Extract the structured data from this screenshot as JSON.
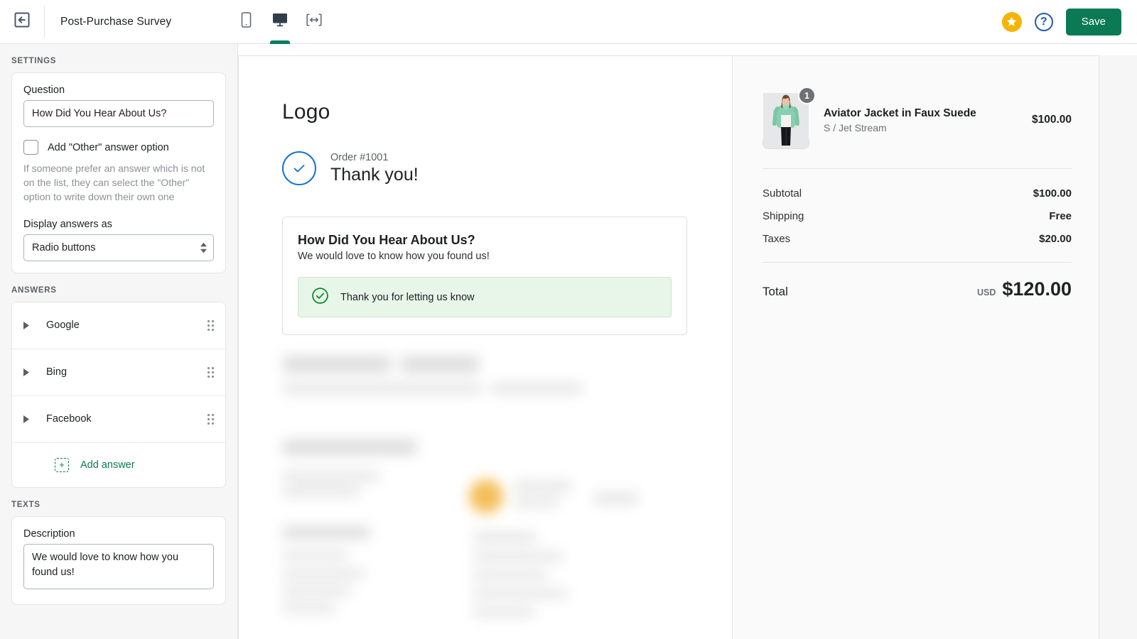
{
  "topbar": {
    "back_icon": "arrow-left-in-box-icon",
    "title": "Post-Purchase Survey",
    "devices": [
      {
        "name": "mobile",
        "icon": "mobile-icon",
        "active": false
      },
      {
        "name": "desktop",
        "icon": "desktop-monitor-icon",
        "active": true
      },
      {
        "name": "full-width",
        "icon": "full-width-icon",
        "active": false
      }
    ],
    "star_icon": "star-icon",
    "help_icon": "question-mark-icon",
    "help_label": "?",
    "save_label": "Save",
    "accent_green": "#0b7a54",
    "star_yellow": "#f5b400",
    "help_blue": "#1f5fa9"
  },
  "sidebar": {
    "settings_heading": "SETTINGS",
    "question_label": "Question",
    "question_value": "How Did You Hear About Us?",
    "other_checkbox_label": "Add \"Other\" answer option",
    "other_help_text": "If someone prefer an answer which is not on the list, they can select the \"Other\" option to write down their own one",
    "display_as_label": "Display answers as",
    "display_as_value": "Radio buttons",
    "answers_heading": "ANSWERS",
    "answers": [
      {
        "label": "Google"
      },
      {
        "label": "Bing"
      },
      {
        "label": "Facebook"
      }
    ],
    "add_answer_label": "Add answer",
    "texts_heading": "TEXTS",
    "description_label": "Description",
    "description_value": "We would love to know how you found us!"
  },
  "preview": {
    "logo_text": "Logo",
    "order_number": "Order #1001",
    "thank_you": "Thank you!",
    "survey": {
      "question": "How Did You Hear About Us?",
      "subtitle": "We would love to know how you found us!",
      "success_message": "Thank you for letting us know",
      "success_bg": "#e8f5e9",
      "success_icon": "check-circle-icon"
    },
    "check_icon": "check-circle-outline-icon",
    "summary": {
      "item": {
        "title": "Aviator Jacket in Faux Suede",
        "variant": "S / Jet Stream",
        "price": "$100.00",
        "quantity": "1",
        "thumb_alt": "model-wearing-mint-green-jacket"
      },
      "rows": [
        {
          "label": "Subtotal",
          "value": "$100.00"
        },
        {
          "label": "Shipping",
          "value": "Free"
        },
        {
          "label": "Taxes",
          "value": "$20.00"
        }
      ],
      "total_label": "Total",
      "total_currency": "USD",
      "total_amount": "$120.00"
    }
  }
}
